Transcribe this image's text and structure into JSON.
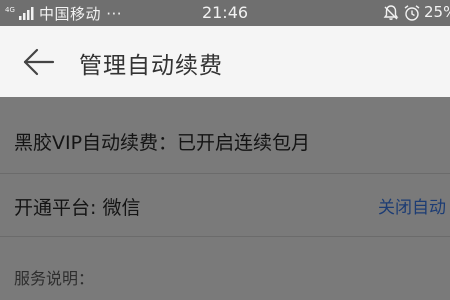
{
  "status_bar": {
    "signal_text": "4G",
    "carrier": "中国移动 ···",
    "time": "21:46",
    "icons": [
      "bell-off-icon",
      "alarm-icon"
    ],
    "battery": "25%"
  },
  "header": {
    "back_icon": "arrow-left-icon",
    "title": "管理自动续费"
  },
  "rows": {
    "vip_status": "黑胶VIP自动续费：已开启连续包月",
    "platform": "开通平台: 微信",
    "close_link": "关闭自动"
  },
  "section": {
    "service_label": "服务说明："
  },
  "colors": {
    "overlay": "#7a7a7a",
    "header_bg": "#f5f5f5",
    "link": "#1c3c74"
  }
}
